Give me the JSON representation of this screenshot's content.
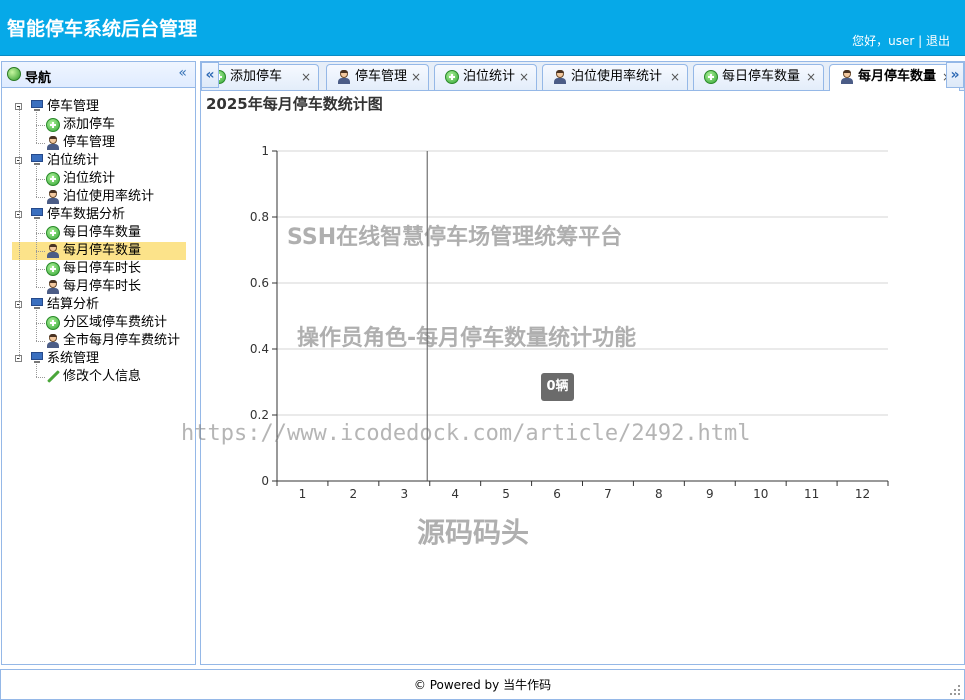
{
  "header": {
    "title": "智能停车系统后台管理",
    "greeting": "您好，user",
    "separator": "|",
    "logout": "退出"
  },
  "sidebar": {
    "title": "导航",
    "collapse_glyph": "«",
    "groups": [
      {
        "label": "停车管理",
        "items": [
          {
            "label": "添加停车",
            "icon": "plus-icon"
          },
          {
            "label": "停车管理",
            "icon": "person-icon"
          }
        ]
      },
      {
        "label": "泊位统计",
        "items": [
          {
            "label": "泊位统计",
            "icon": "plus-icon"
          },
          {
            "label": "泊位使用率统计",
            "icon": "person-icon"
          }
        ]
      },
      {
        "label": "停车数据分析",
        "items": [
          {
            "label": "每日停车数量",
            "icon": "plus-icon"
          },
          {
            "label": "每月停车数量",
            "icon": "person-icon",
            "selected": true
          },
          {
            "label": "每日停车时长",
            "icon": "plus-icon"
          },
          {
            "label": "每月停车时长",
            "icon": "person-icon"
          }
        ]
      },
      {
        "label": "结算分析",
        "items": [
          {
            "label": "分区域停车费统计",
            "icon": "plus-icon"
          },
          {
            "label": "全市每月停车费统计",
            "icon": "person-icon"
          }
        ]
      },
      {
        "label": "系统管理",
        "items": [
          {
            "label": "修改个人信息",
            "icon": "pencil-icon"
          }
        ]
      }
    ]
  },
  "tabs": {
    "scroll_left": "«",
    "scroll_right": "»",
    "close_glyph": "×",
    "items": [
      {
        "label": "添加停车",
        "icon": "plus-icon"
      },
      {
        "label": "停车管理",
        "icon": "person-icon"
      },
      {
        "label": "泊位统计",
        "icon": "plus-icon"
      },
      {
        "label": "泊位使用率统计",
        "icon": "person-icon"
      },
      {
        "label": "每日停车数量",
        "icon": "plus-icon"
      },
      {
        "label": "每月停车数量",
        "icon": "person-icon",
        "active": true
      }
    ]
  },
  "chart_data": {
    "type": "bar",
    "title": "2025年每月停车数统计图",
    "categories": [
      "1",
      "2",
      "3",
      "4",
      "5",
      "6",
      "7",
      "8",
      "9",
      "10",
      "11",
      "12"
    ],
    "values": [
      0,
      0,
      0,
      0,
      0,
      0,
      0,
      0,
      0,
      0,
      0,
      0
    ],
    "ylim": [
      0,
      1
    ],
    "yticks": [
      "0",
      "0.2",
      "0.4",
      "0.6",
      "0.8",
      "1"
    ],
    "grid": true,
    "hover_category": "3",
    "tooltip": "0辆"
  },
  "watermarks": {
    "platform": "SSH在线智慧停车场管理统筹平台",
    "role": "操作员角色-每月停车数量统计功能",
    "url": "https://www.icodedock.com/article/2492.html",
    "brand": "源码码头"
  },
  "footer": {
    "text": "© Powered by 当牛作码"
  },
  "colors": {
    "header_bg": "#06a9e8",
    "border": "#95b8e7",
    "selected_bg": "#fce38a"
  }
}
